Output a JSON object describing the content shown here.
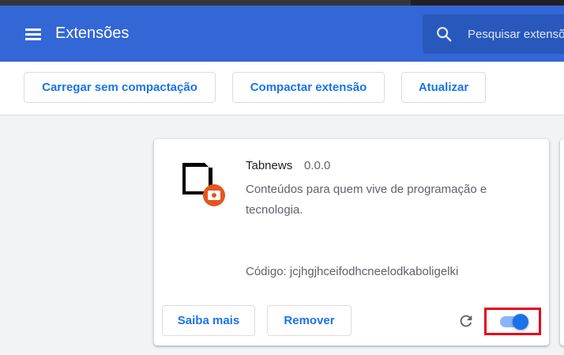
{
  "header": {
    "title": "Extensões",
    "menu_icon": "hamburger-menu-icon",
    "search": {
      "placeholder": "Pesquisar extensões",
      "icon": "search-icon"
    },
    "color": "#3367d6"
  },
  "toolbar": {
    "load_unpacked_label": "Carregar sem compactação",
    "pack_extension_label": "Compactar extensão",
    "update_label": "Atualizar"
  },
  "extension": {
    "name": "Tabnews",
    "version": "0.0.0",
    "description": "Conteúdos para quem vive de programação e tecnologia.",
    "id_text": "Código: jcjhgjhceifodhcneelodkaboligelki",
    "icon": "unpacked-extension-folder-icon",
    "details_label": "Saiba mais",
    "remove_label": "Remover",
    "reload_icon": "reload-icon",
    "enabled": true
  },
  "colors": {
    "accent": "#1a73e8",
    "highlight_border": "#e8001c"
  }
}
